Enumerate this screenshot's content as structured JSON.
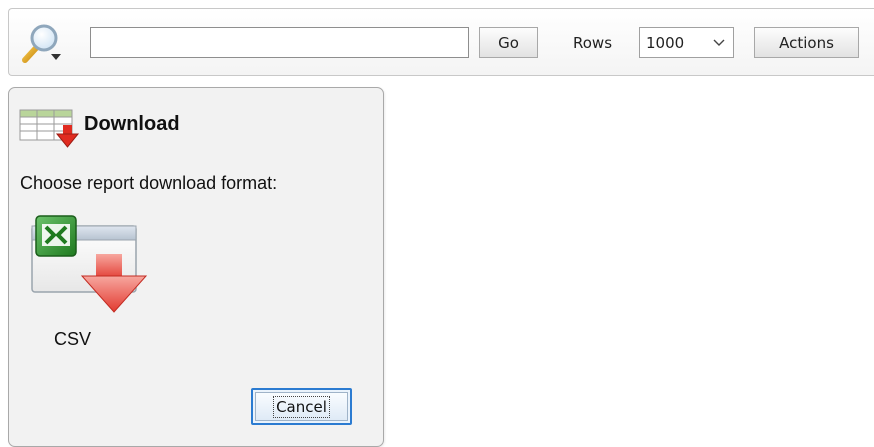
{
  "toolbar": {
    "search": {
      "value": "",
      "placeholder": ""
    },
    "go_label": "Go",
    "rows_label": "Rows",
    "rows_value": "1000",
    "actions_label": "Actions"
  },
  "dialog": {
    "title": "Download",
    "prompt": "Choose report download format:",
    "formats": [
      {
        "label": "CSV",
        "icon": "excel-download-icon"
      }
    ],
    "cancel_label": "Cancel"
  },
  "colors": {
    "dialog_background": "#f2f2f2",
    "focus_ring": "#2b7bd1",
    "download_arrow": "#e8413a",
    "excel_green": "#2e8b2e"
  },
  "icons": {
    "search": "magnifier-dropdown-icon",
    "dialog_header": "table-download-icon",
    "rows_dropdown": "chevron-down-icon"
  }
}
